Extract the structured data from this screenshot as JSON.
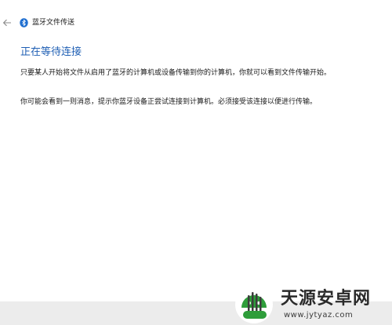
{
  "window": {
    "title": "蓝牙文件传送"
  },
  "content": {
    "heading": "正在等待连接",
    "paragraph_1": "只要某人开始将文件从启用了蓝牙的计算机或设备传输到你的计算机，你就可以看到文件传输开始。",
    "paragraph_2": "你可能会看到一则消息，提示你蓝牙设备正尝试连接到计算机。必须接受该连接以便进行传输。"
  },
  "watermark": {
    "name": "天源安卓网",
    "url": "www.jytyaz.com"
  },
  "icons": {
    "back": "back-arrow-icon",
    "bluetooth": "bluetooth-icon"
  },
  "colors": {
    "heading": "#1f5fb4",
    "bluetooth_badge": "#1f6fd0",
    "watermark_green": "#2e9d3a"
  }
}
